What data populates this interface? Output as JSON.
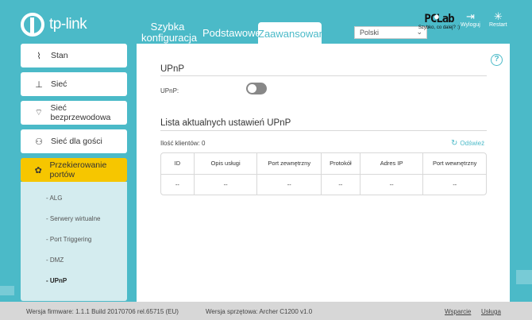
{
  "header": {
    "logo_text": "tp-link",
    "tabs": {
      "quick_setup": "Szybka konfiguracja",
      "basic": "Podstawowe",
      "advanced": "Zaawansowane"
    },
    "language": "Polski",
    "logout_label": "Wyloguj",
    "reset_label": "Restart",
    "watermark": {
      "big": "PCLab",
      "small": "Szybko, co dalej? :)"
    }
  },
  "sidebar": {
    "items": [
      {
        "label": "Stan",
        "icon": "pulse-icon"
      },
      {
        "label": "Sieć",
        "icon": "network-icon"
      },
      {
        "label": "Sieć bezprzewodowa",
        "icon": "wifi-icon"
      },
      {
        "label": "Sieć dla gości",
        "icon": "guests-icon"
      },
      {
        "label": "Przekierowanie portów",
        "icon": "port-forward-icon"
      }
    ],
    "sub_items": [
      "- ALG",
      "- Serwery wirtualne",
      "- Port Triggering",
      "- DMZ",
      "- UPnP"
    ]
  },
  "main": {
    "upnp_title": "UPnP",
    "upnp_label": "UPnP:",
    "upnp_enabled": false,
    "list_title": "Lista aktualnych ustawień UPnP",
    "client_count_label": "Ilość klientów: 0",
    "refresh_label": "Odśwież",
    "table": {
      "headers": [
        "ID",
        "Opis usługi",
        "Port zewnętrzny",
        "Protokół",
        "Adres IP",
        "Port wewnętrzny"
      ],
      "rows": [
        [
          "--",
          "--",
          "--",
          "--",
          "--",
          "--"
        ]
      ]
    }
  },
  "footer": {
    "firmware": "Wersja firmware: 1.1.1 Build 20170706 rel.65715 (EU)",
    "hardware": "Wersja sprzętowa: Archer C1200 v1.0",
    "support": "Wsparcie",
    "app": "Usługa"
  },
  "colors": {
    "accent": "#4bbac8",
    "active": "#f6c600",
    "footer": "#d7d7d7"
  }
}
